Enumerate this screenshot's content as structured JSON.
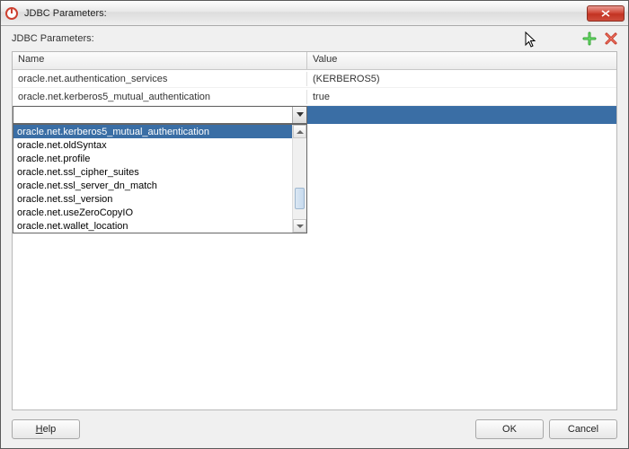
{
  "window": {
    "title": "JDBC Parameters:"
  },
  "panel": {
    "label": "JDBC Parameters:"
  },
  "grid": {
    "header": {
      "name": "Name",
      "value": "Value"
    },
    "rows": [
      {
        "name": "oracle.net.authentication_services",
        "value": "(KERBEROS5)"
      },
      {
        "name": "oracle.net.kerberos5_mutual_authentication",
        "value": "true"
      }
    ],
    "edit": {
      "value": ""
    }
  },
  "dropdown": {
    "items": [
      "oracle.net.kerberos5_mutual_authentication",
      "oracle.net.oldSyntax",
      "oracle.net.profile",
      "oracle.net.ssl_cipher_suites",
      "oracle.net.ssl_server_dn_match",
      "oracle.net.ssl_version",
      "oracle.net.useZeroCopyIO",
      "oracle.net.wallet_location"
    ],
    "selected_index": 0
  },
  "buttons": {
    "help_prefix": "H",
    "help_rest": "elp",
    "ok": "OK",
    "cancel": "Cancel"
  },
  "icons": {
    "close": "X",
    "add": "add",
    "delete": "delete",
    "dropdown": "▼",
    "up": "▴",
    "down": "▾"
  }
}
